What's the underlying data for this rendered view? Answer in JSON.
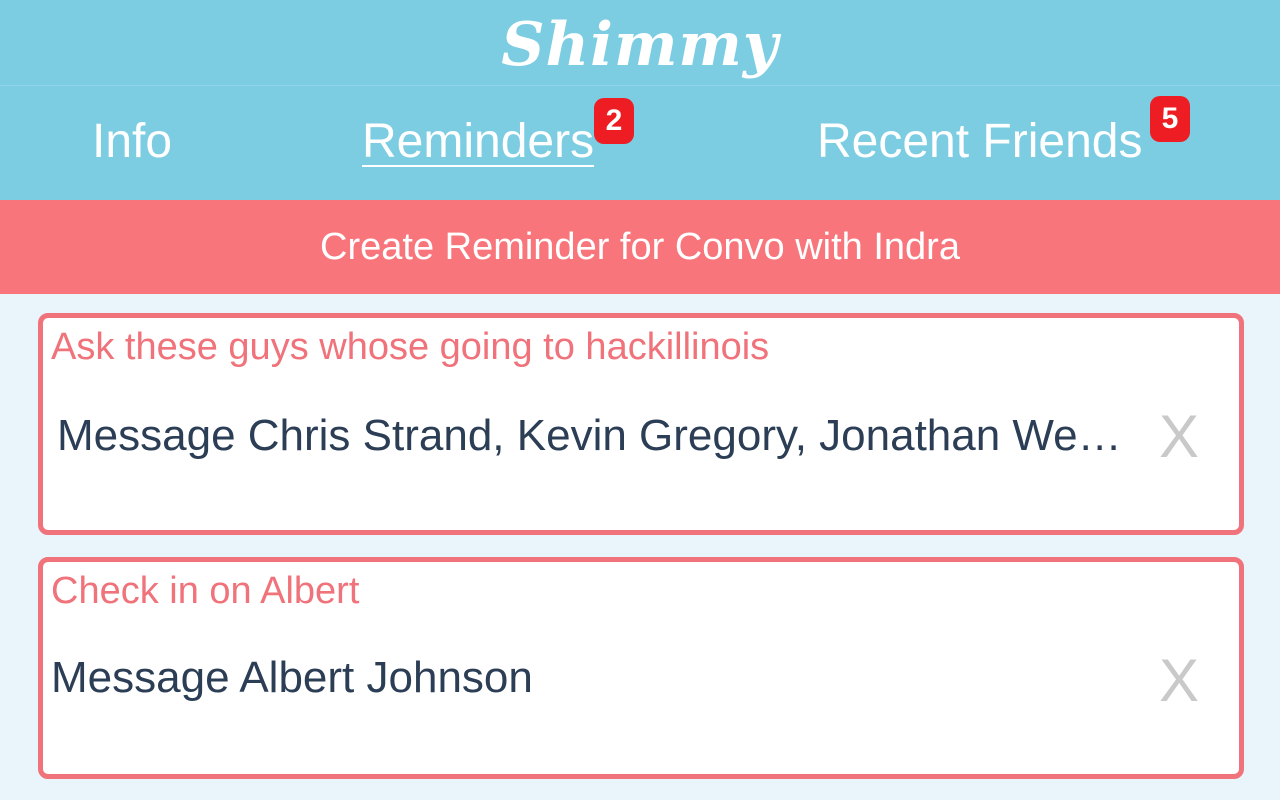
{
  "app": {
    "title": "Shimmy"
  },
  "tabs": [
    {
      "label": "Info",
      "badge": null,
      "active": false
    },
    {
      "label": "Reminders",
      "badge": "2",
      "active": true
    },
    {
      "label": "Recent Friends",
      "badge": "5",
      "active": false
    }
  ],
  "create_reminder": {
    "label": "Create Reminder for Convo with Indra"
  },
  "reminders": [
    {
      "title": "Ask these guys whose going to hackillinois",
      "message": "Message Chris Strand, Kevin Gregory, Jonathan Weber",
      "close_label": "X"
    },
    {
      "title": "Check in on Albert",
      "message": "Message Albert Johnson",
      "close_label": "X"
    }
  ],
  "colors": {
    "header_bg": "#7dcde2",
    "accent_coral": "#f8767b",
    "badge_red": "#ee1d23",
    "text_dark": "#2c3e55",
    "page_bg": "#e9f4fb"
  }
}
